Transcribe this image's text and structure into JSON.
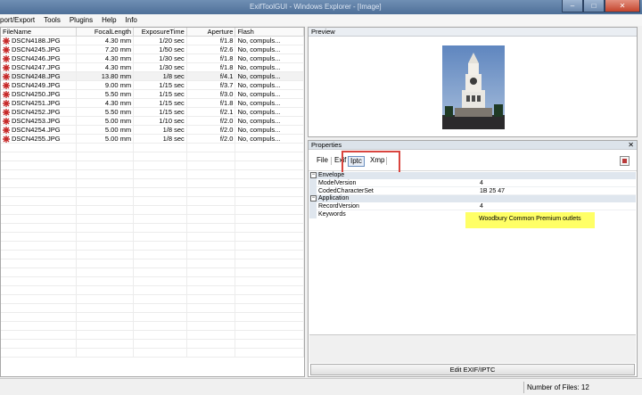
{
  "window": {
    "title": "ExifToolGUI - Windows Explorer - [Image]"
  },
  "menu": [
    "port/Export",
    "Tools",
    "Plugins",
    "Help",
    "Info"
  ],
  "filelist": {
    "columns": [
      "FileName",
      "FocalLength",
      "ExposureTime",
      "Aperture",
      "Flash"
    ],
    "rows": [
      [
        "DSCN4188.JPG",
        "4.30 mm",
        "1/20 sec",
        "f/1.8",
        "No, compuls..."
      ],
      [
        "DSCN4245.JPG",
        "7.20 mm",
        "1/50 sec",
        "f/2.6",
        "No, compuls..."
      ],
      [
        "DSCN4246.JPG",
        "4.30 mm",
        "1/30 sec",
        "f/1.8",
        "No, compuls..."
      ],
      [
        "DSCN4247.JPG",
        "4.30 mm",
        "1/30 sec",
        "f/1.8",
        "No, compuls..."
      ],
      [
        "DSCN4248.JPG",
        "13.80 mm",
        "1/8 sec",
        "f/4.1",
        "No, compuls..."
      ],
      [
        "DSCN4249.JPG",
        "9.00 mm",
        "1/15 sec",
        "f/3.7",
        "No, compuls..."
      ],
      [
        "DSCN4250.JPG",
        "5.50 mm",
        "1/15 sec",
        "f/3.0",
        "No, compuls..."
      ],
      [
        "DSCN4251.JPG",
        "4.30 mm",
        "1/15 sec",
        "f/1.8",
        "No, compuls..."
      ],
      [
        "DSCN4252.JPG",
        "5.50 mm",
        "1/15 sec",
        "f/2.1",
        "No, compuls..."
      ],
      [
        "DSCN4253.JPG",
        "5.00 mm",
        "1/10 sec",
        "f/2.0",
        "No, compuls..."
      ],
      [
        "DSCN4254.JPG",
        "5.00 mm",
        "1/8 sec",
        "f/2.0",
        "No, compuls..."
      ],
      [
        "DSCN4255.JPG",
        "5.00 mm",
        "1/8 sec",
        "f/2.0",
        "No, compuls..."
      ]
    ],
    "selected_index": 4
  },
  "preview": {
    "title": "Preview"
  },
  "properties": {
    "title": "Properties",
    "tabs": [
      "File",
      "Exif",
      "Iptc",
      "Xmp"
    ],
    "active_tab": "Iptc",
    "sections": [
      {
        "name": "Envelope",
        "rows": [
          [
            "ModelVersion",
            "4"
          ],
          [
            "CodedCharacterSet",
            "1B 25 47"
          ]
        ]
      },
      {
        "name": "Application",
        "rows": [
          [
            "RecordVersion",
            "4"
          ],
          [
            "Keywords",
            ""
          ]
        ]
      }
    ],
    "keywords_value": "Woodbury Common Premium outlets",
    "edit_button": "Edit EXIF/IPTC"
  },
  "status": {
    "files_text": "Number of Files: 12"
  },
  "colors": {
    "highlight": "#ffff66",
    "callout": "#d9453f",
    "titlebar": "#5a7aa3"
  }
}
